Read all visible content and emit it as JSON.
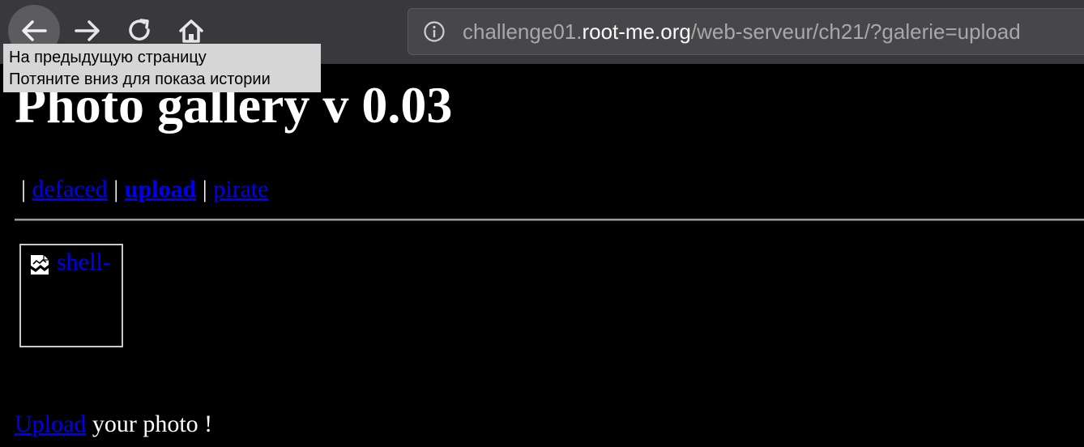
{
  "browser": {
    "url": {
      "prefix": "challenge01.",
      "domain": "root-me.org",
      "path": "/web-serveur/ch21/?galerie=upload"
    },
    "icons": [
      "back-arrow-icon",
      "forward-arrow-icon",
      "reload-icon",
      "home-icon",
      "info-icon"
    ],
    "tooltip": {
      "line1": "На предыдущую страницу",
      "line2": "Потяните вниз для показа истории"
    }
  },
  "page": {
    "title": "Photo gallery v 0.03",
    "nav": {
      "separator": "|",
      "links": [
        {
          "label": "defaced",
          "active": false
        },
        {
          "label": "upload",
          "active": true
        },
        {
          "label": "pirate",
          "active": false
        }
      ]
    },
    "gallery": {
      "items": [
        {
          "alt_text": "shell-",
          "icon": "broken-image-icon"
        }
      ]
    },
    "footer": {
      "link_label": "Upload",
      "text": " your photo !"
    }
  },
  "colors": {
    "link": "#0000ee",
    "background": "#000000",
    "toolbar": "#38383d",
    "tooltip": "#d6d6d6"
  }
}
